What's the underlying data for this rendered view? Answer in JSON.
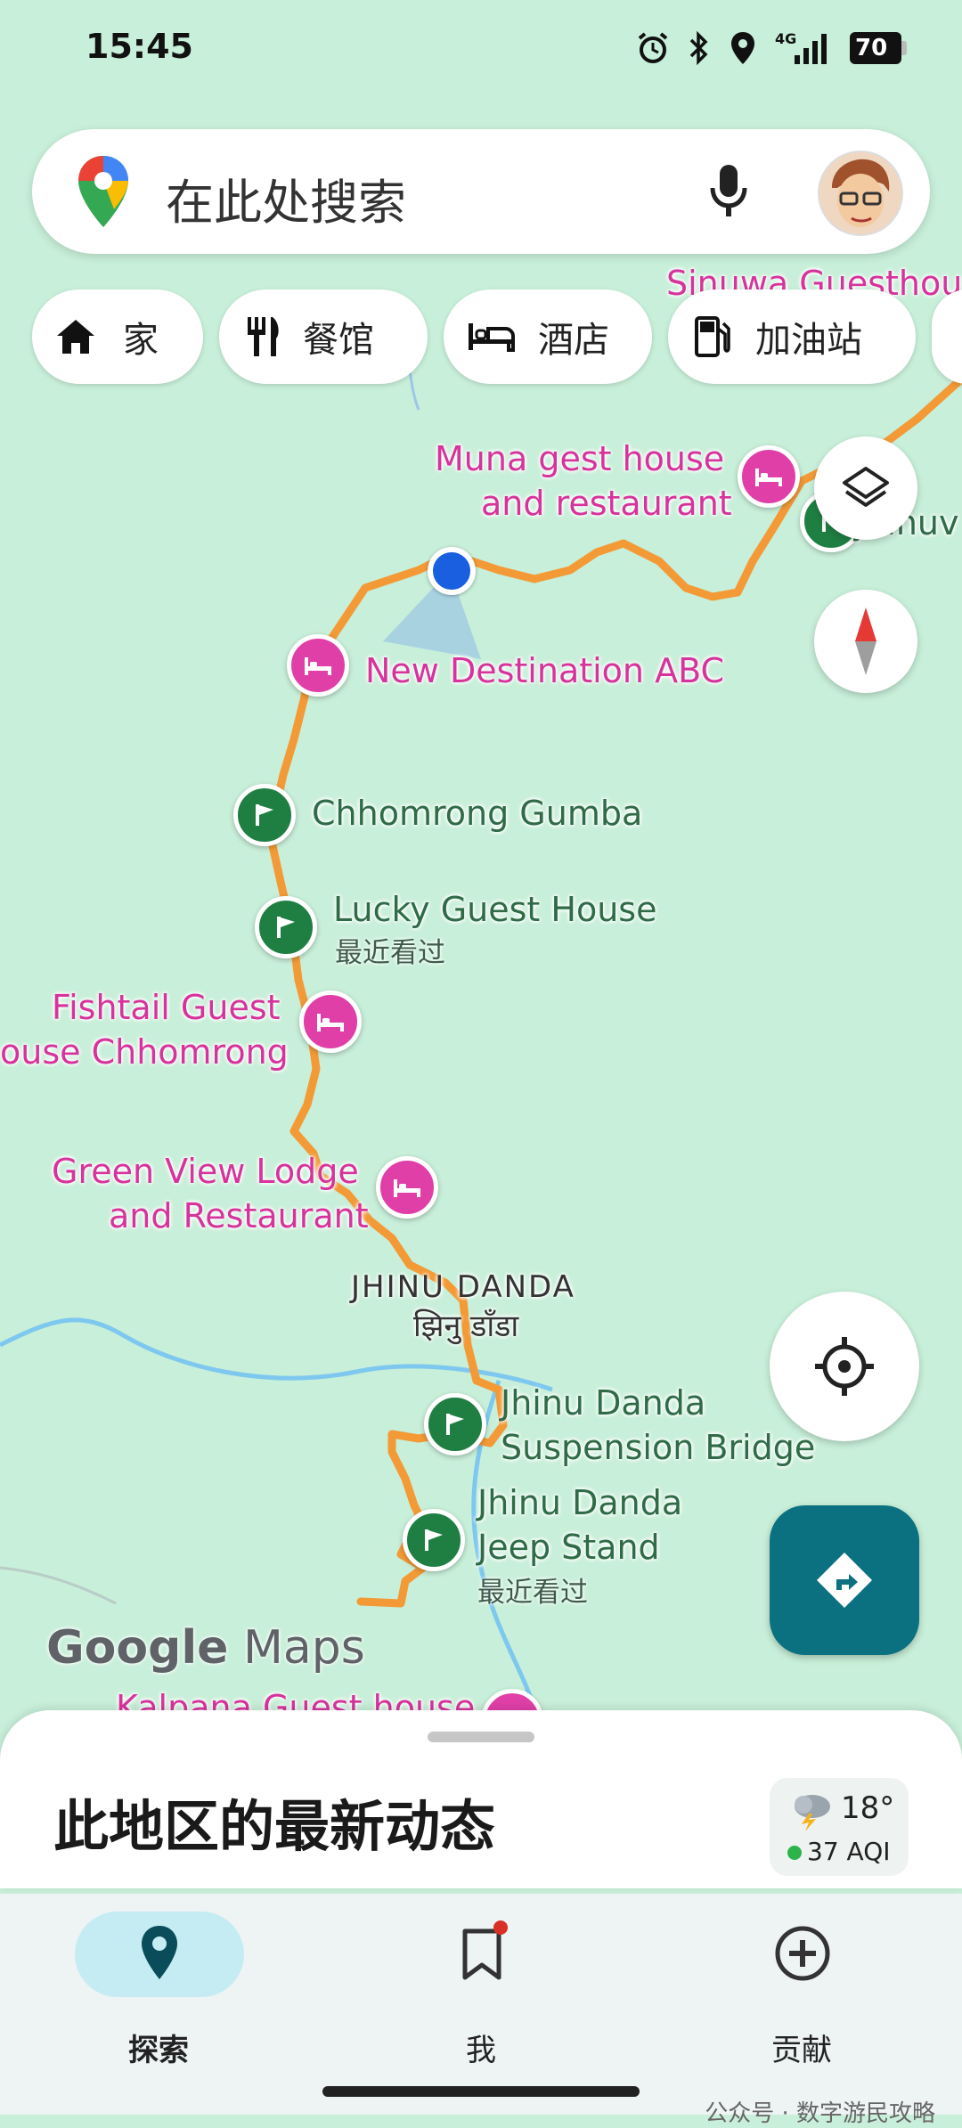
{
  "status_bar": {
    "time": "15:45",
    "network": "4G",
    "battery": "70"
  },
  "search": {
    "placeholder": "在此处搜索"
  },
  "chips": [
    {
      "label": "家",
      "icon": "home-icon"
    },
    {
      "label": "餐馆",
      "icon": "restaurant-icon"
    },
    {
      "label": "酒店",
      "icon": "hotel-icon"
    },
    {
      "label": "加油站",
      "icon": "gas-station-icon"
    }
  ],
  "map": {
    "labels": {
      "sinuwa": "Sinuwa Guesthou",
      "muna_line1": "Muna gest house",
      "muna_line2": "and restaurant",
      "jhinu_cut": "Jhinuv",
      "new_destination": "New Destination ABC",
      "chhomrong_gumba": "Chhomrong Gumba",
      "lucky_guest": "Lucky Guest House",
      "lucky_sub": "最近看过",
      "fishtail_line1": "Fishtail Guest",
      "fishtail_line2": "ouse Chhomrong",
      "green_view_line1": "Green View Lodge",
      "green_view_line2": "and Restaurant",
      "jhinu_danda": "JHINU DANDA",
      "jhinu_danda_nepali": "झिनु डाँडा",
      "bridge_line1": "Jhinu Danda",
      "bridge_line2": "Suspension Bridge",
      "jeep_line1": "Jhinu Danda",
      "jeep_line2": "Jeep Stand",
      "jeep_sub": "最近看过",
      "kalpana": "Kalpana Guest house"
    },
    "logo": {
      "google": "Google",
      "maps": "Maps"
    }
  },
  "sheet": {
    "title": "此地区的最新动态",
    "weather": {
      "temp": "18°",
      "aqi": "37 AQI"
    }
  },
  "nav": [
    {
      "label": "探索",
      "icon": "explore-pin-icon",
      "active": true
    },
    {
      "label": "我",
      "icon": "bookmark-icon",
      "active": false
    },
    {
      "label": "贡献",
      "icon": "add-circle-icon",
      "active": false
    }
  ],
  "watermark": "公众号 · 数字游民攻略",
  "colors": {
    "map_bg": "#c8efd9",
    "route": "#f39a37",
    "pink_poi": "#e03fa8",
    "green_poi": "#1f7f43",
    "directions_fab": "#0b7080",
    "location_dot": "#1a5fe0"
  }
}
